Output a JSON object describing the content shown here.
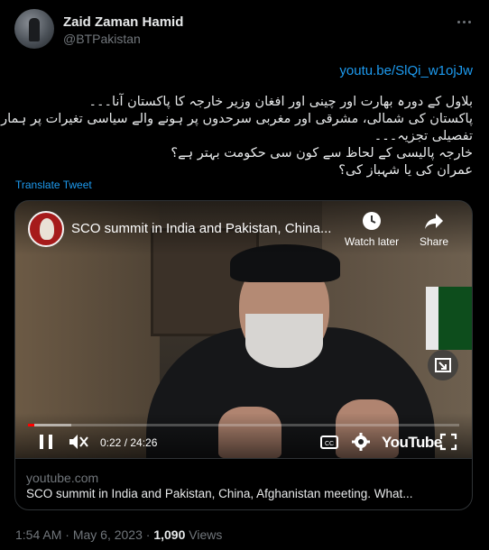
{
  "tweet": {
    "author_name": "Zaid Zaman Hamid",
    "author_handle": "@BTPakistan",
    "more_icon": "more-horizontal-icon",
    "link": "youtu.be/SlQi_w1ojJw",
    "lines": [
      "بلاول کے دورہ بھارت اور چینی اور افغان وزیر خارجہ کا پاکستان آنا۔۔۔",
      "پاکستان کی شمالی، مشرقی اور مغربی سرحدوں پر ہونے والے سیاسی تغیرات پر ہمارا",
      "تفصیلی تجزیہ۔۔۔",
      "خارجہ پالیسی کے لحاظ سے کون سی حکومت بہتر ہے؟",
      "عمران کی یا شہباز کی؟"
    ],
    "translate_label": "Translate Tweet",
    "time": "1:54 AM",
    "date": "May 6, 2023",
    "separator": "·",
    "views_count": "1,090",
    "views_label": "Views"
  },
  "video": {
    "title": "SCO summit in India and Pakistan, China...",
    "watch_later_label": "Watch later",
    "share_label": "Share",
    "current_time": "0:22",
    "duration": "24:26",
    "time_display": "0:22 / 24:26",
    "progress_fraction": 0.015,
    "buffer_fraction": 0.1,
    "logo_text": "YouTube",
    "accent_color": "#ff0000"
  },
  "card": {
    "domain": "youtube.com",
    "title": "SCO summit in India and Pakistan, China, Afghanistan meeting. What..."
  }
}
